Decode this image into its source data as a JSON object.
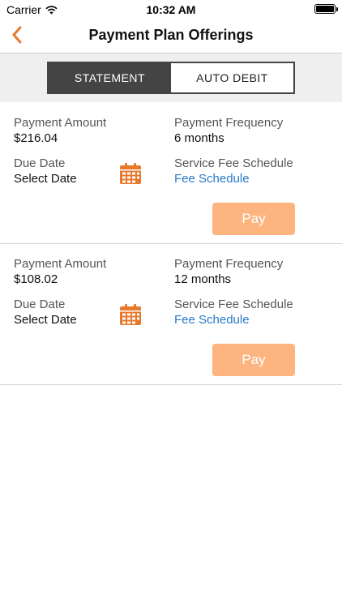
{
  "status_bar": {
    "carrier": "Carrier",
    "time": "10:32 AM"
  },
  "nav": {
    "title": "Payment Plan Offerings",
    "back_icon": "chevron-left-icon",
    "accent_color": "#e8792c"
  },
  "segments": {
    "statement": "STATEMENT",
    "auto_debit": "AUTO DEBIT",
    "selected": "statement"
  },
  "plans": [
    {
      "amount_label": "Payment Amount",
      "amount": "$216.04",
      "frequency_label": "Payment Frequency",
      "frequency": "6 months",
      "due_label": "Due Date",
      "due_value": "Select Date",
      "fee_label": "Service Fee Schedule",
      "fee_link": "Fee Schedule",
      "pay_label": "Pay"
    },
    {
      "amount_label": "Payment Amount",
      "amount": "$108.02",
      "frequency_label": "Payment Frequency",
      "frequency": "12 months",
      "due_label": "Due Date",
      "due_value": "Select Date",
      "fee_label": "Service Fee Schedule",
      "fee_link": "Fee Schedule",
      "pay_label": "Pay"
    }
  ],
  "colors": {
    "accent": "#e8792c",
    "pay_button": "#fdb47f",
    "link": "#2a78c8",
    "segment_active": "#444444"
  }
}
